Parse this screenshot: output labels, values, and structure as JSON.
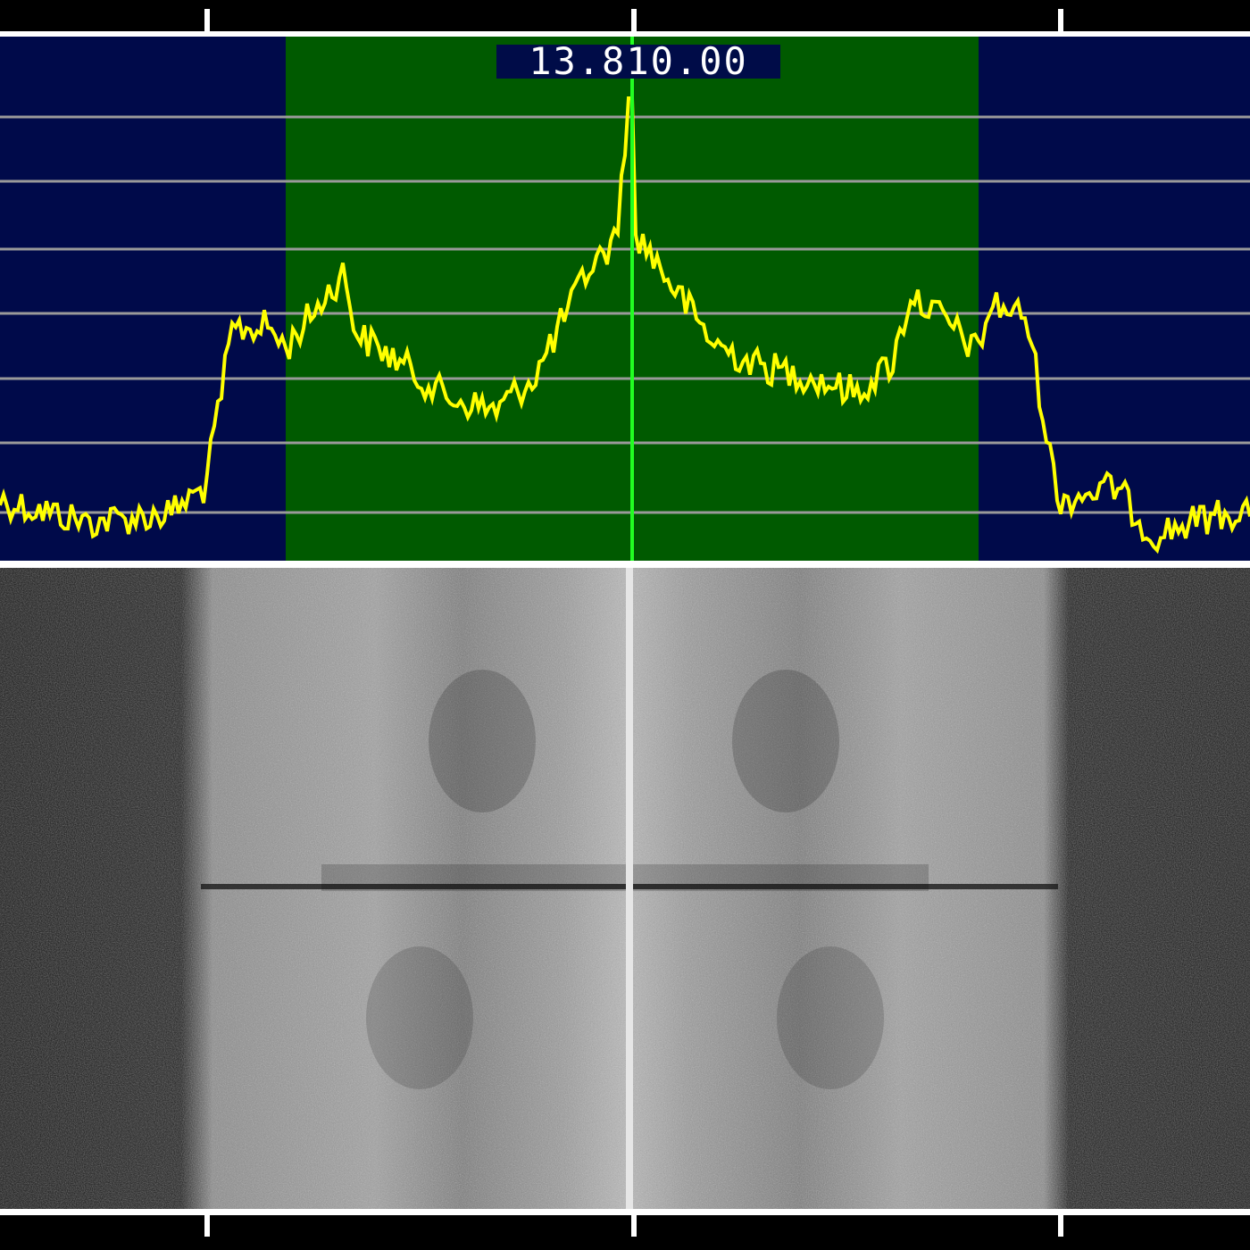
{
  "tuning": {
    "frequency_label": "13.810.00"
  },
  "colors": {
    "background": "#000000",
    "spectrum_bg": "#000a4a",
    "passband": "#005a00",
    "trace": "#ffff00",
    "tuning_line": "#22ff22",
    "grid": "#9a9a9a",
    "frame": "#ffffff"
  },
  "icons": {
    "top_ruler": "frequency-scale",
    "bottom_ruler": "frequency-scale",
    "waterfall": "waterfall-spectrogram"
  }
}
